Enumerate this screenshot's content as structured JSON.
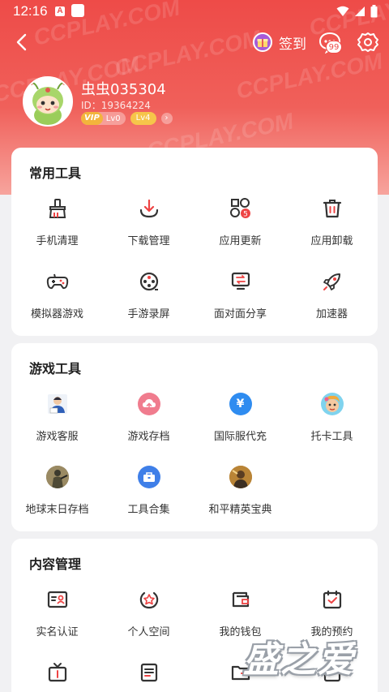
{
  "status": {
    "time": "12:16",
    "notif_letter": "A"
  },
  "header": {
    "watermark": "CCPLAY.COM",
    "signin_label": "签到",
    "message_badge": "99"
  },
  "user": {
    "name": "虫虫035304",
    "id_text": "ID：19364224",
    "vip_label": "VIP",
    "vip_level": "Lv0",
    "level": "Lv4"
  },
  "sections": [
    {
      "title": "常用工具",
      "items": [
        {
          "label": "手机清理",
          "icon": "broom-icon"
        },
        {
          "label": "下载管理",
          "icon": "download-icon"
        },
        {
          "label": "应用更新",
          "icon": "apps-update-icon",
          "badge": "5"
        },
        {
          "label": "应用卸载",
          "icon": "trash-icon"
        },
        {
          "label": "模拟器游戏",
          "icon": "gamepad-icon"
        },
        {
          "label": "手游录屏",
          "icon": "record-icon"
        },
        {
          "label": "面对面分享",
          "icon": "share-transfer-icon"
        },
        {
          "label": "加速器",
          "icon": "rocket-icon"
        }
      ]
    },
    {
      "title": "游戏工具",
      "items": [
        {
          "label": "游戏客服",
          "icon": "customer-service-icon"
        },
        {
          "label": "游戏存档",
          "icon": "cloud-upload-icon"
        },
        {
          "label": "国际服代充",
          "icon": "yen-icon"
        },
        {
          "label": "托卡工具",
          "icon": "toca-avatar-icon"
        },
        {
          "label": "地球末日存档",
          "icon": "survival-game-icon"
        },
        {
          "label": "工具合集",
          "icon": "toolbox-icon"
        },
        {
          "label": "和平精英宝典",
          "icon": "peace-elite-icon"
        }
      ]
    },
    {
      "title": "内容管理",
      "items": [
        {
          "label": "实名认证",
          "icon": "id-card-icon"
        },
        {
          "label": "个人空间",
          "icon": "star-badge-icon"
        },
        {
          "label": "我的钱包",
          "icon": "wallet-icon"
        },
        {
          "label": "我的预约",
          "icon": "calendar-check-icon"
        },
        {
          "label": "",
          "icon": "tv-icon"
        },
        {
          "label": "",
          "icon": "document-icon"
        },
        {
          "label": "",
          "icon": "folder-icon"
        },
        {
          "label": "",
          "icon": "clipboard-icon"
        }
      ]
    }
  ],
  "colors": {
    "brand": "#ee4b48",
    "accent_purple": "#a75bd8",
    "accent_blue": "#2f8cf0",
    "accent_pink": "#f07c8e"
  },
  "logo_text": "盛之爱"
}
